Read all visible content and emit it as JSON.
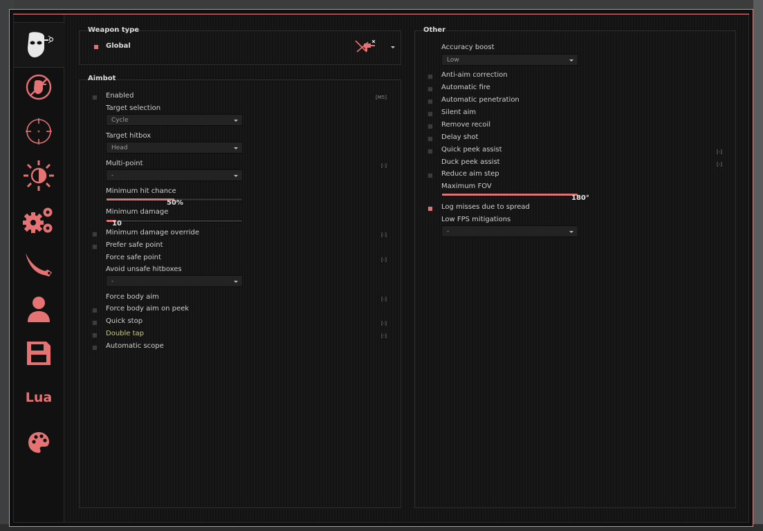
{
  "sidebar": {
    "tabs": [
      {
        "name": "rage",
        "icon": "masked-head-icon",
        "active": true
      },
      {
        "name": "anti-aim",
        "icon": "crossed-head-icon",
        "active": false
      },
      {
        "name": "legit",
        "icon": "crosshair-icon",
        "active": false
      },
      {
        "name": "visuals",
        "icon": "half-sun-icon",
        "active": false
      },
      {
        "name": "misc",
        "icon": "gears-icon",
        "active": false
      },
      {
        "name": "skins",
        "icon": "karambit-icon",
        "active": false
      },
      {
        "name": "players",
        "icon": "user-icon",
        "active": false
      },
      {
        "name": "config",
        "icon": "floppy-disk-icon",
        "active": false
      },
      {
        "name": "lua",
        "icon": "lua-text",
        "label": "Lua",
        "active": false
      },
      {
        "name": "theme",
        "icon": "palette-icon",
        "active": false
      }
    ]
  },
  "weapon_type": {
    "title": "Weapon type",
    "selected": "Global",
    "icon": "weapon-icon"
  },
  "aimbot": {
    "title": "Aimbot",
    "enabled_label": "Enabled",
    "enabled_key": "[M5]",
    "target_selection_label": "Target selection",
    "target_selection_value": "Cycle",
    "target_hitbox_label": "Target hitbox",
    "target_hitbox_value": "Head",
    "multipoint_label": "Multi-point",
    "multipoint_key": "[-]",
    "multipoint_value": "-",
    "min_hit_chance_label": "Minimum hit chance",
    "min_hit_chance_value": "50%",
    "min_hit_chance_fraction": 0.5,
    "min_damage_label": "Minimum damage",
    "min_damage_value": "10",
    "min_damage_fraction": 0.07,
    "min_damage_override_label": "Minimum damage override",
    "min_damage_override_key": "[-]",
    "prefer_safe_point_label": "Prefer safe point",
    "force_safe_point_label": "Force safe point",
    "force_safe_point_key": "[-]",
    "avoid_unsafe_label": "Avoid unsafe hitboxes",
    "avoid_unsafe_value": "-",
    "force_body_aim_label": "Force body aim",
    "force_body_aim_key": "[-]",
    "force_body_aim_peek_label": "Force body aim on peek",
    "quick_stop_label": "Quick stop",
    "quick_stop_key": "[-]",
    "double_tap_label": "Double tap",
    "double_tap_key": "[-]",
    "automatic_scope_label": "Automatic scope"
  },
  "other": {
    "title": "Other",
    "accuracy_boost_label": "Accuracy boost",
    "accuracy_boost_value": "Low",
    "anti_aim_correction_label": "Anti-aim correction",
    "automatic_fire_label": "Automatic fire",
    "automatic_penetration_label": "Automatic penetration",
    "silent_aim_label": "Silent aim",
    "remove_recoil_label": "Remove recoil",
    "delay_shot_label": "Delay shot",
    "quick_peek_label": "Quick peek assist",
    "quick_peek_key": "[-]",
    "duck_peek_label": "Duck peek assist",
    "duck_peek_key": "[-]",
    "reduce_aim_step_label": "Reduce aim step",
    "max_fov_label": "Maximum FOV",
    "max_fov_value": "180°",
    "max_fov_fraction": 1.0,
    "log_misses_label": "Log misses due to spread",
    "low_fps_label": "Low FPS mitigations",
    "low_fps_value": "-"
  },
  "colors": {
    "accent": "#e07373",
    "border": "#d88a8a",
    "highlight_text": "#c8c886"
  }
}
